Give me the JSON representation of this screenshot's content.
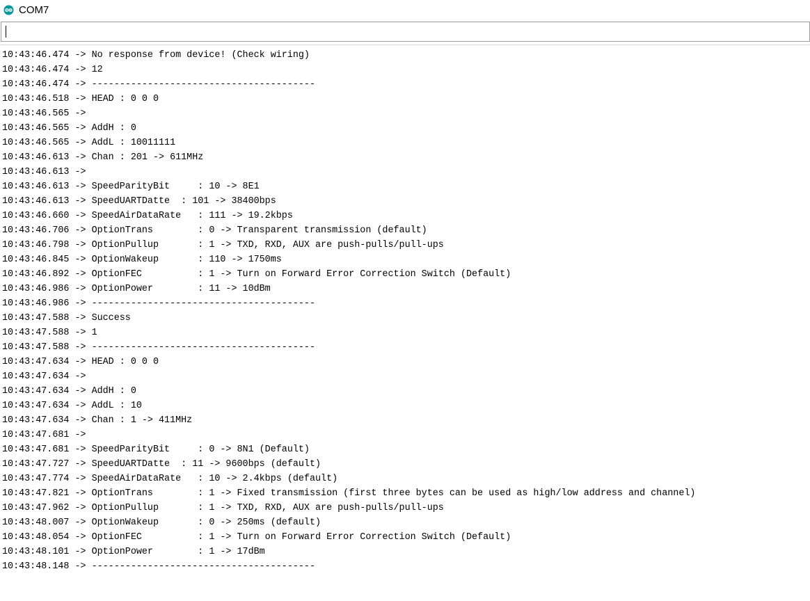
{
  "window": {
    "title": "COM7",
    "icon": "arduino-icon",
    "accent": "#00979c"
  },
  "send_input": {
    "value": "",
    "placeholder": ""
  },
  "serial_output": {
    "lines": [
      "10:43:46.474 -> No response from device! (Check wiring)",
      "10:43:46.474 -> 12",
      "10:43:46.474 -> ----------------------------------------",
      "10:43:46.518 -> HEAD : 0 0 0",
      "10:43:46.565 -> ",
      "10:43:46.565 -> AddH : 0",
      "10:43:46.565 -> AddL : 10011111",
      "10:43:46.613 -> Chan : 201 -> 611MHz",
      "10:43:46.613 -> ",
      "10:43:46.613 -> SpeedParityBit     : 10 -> 8E1",
      "10:43:46.613 -> SpeedUARTDatte  : 101 -> 38400bps",
      "10:43:46.660 -> SpeedAirDataRate   : 111 -> 19.2kbps",
      "10:43:46.706 -> OptionTrans        : 0 -> Transparent transmission (default)",
      "10:43:46.798 -> OptionPullup       : 1 -> TXD, RXD, AUX are push-pulls/pull-ups",
      "10:43:46.845 -> OptionWakeup       : 110 -> 1750ms",
      "10:43:46.892 -> OptionFEC          : 1 -> Turn on Forward Error Correction Switch (Default)",
      "10:43:46.986 -> OptionPower        : 11 -> 10dBm",
      "10:43:46.986 -> ----------------------------------------",
      "10:43:47.588 -> Success",
      "10:43:47.588 -> 1",
      "10:43:47.588 -> ----------------------------------------",
      "10:43:47.634 -> HEAD : 0 0 0",
      "10:43:47.634 -> ",
      "10:43:47.634 -> AddH : 0",
      "10:43:47.634 -> AddL : 10",
      "10:43:47.634 -> Chan : 1 -> 411MHz",
      "10:43:47.681 -> ",
      "10:43:47.681 -> SpeedParityBit     : 0 -> 8N1 (Default)",
      "10:43:47.727 -> SpeedUARTDatte  : 11 -> 9600bps (default)",
      "10:43:47.774 -> SpeedAirDataRate   : 10 -> 2.4kbps (default)",
      "10:43:47.821 -> OptionTrans        : 1 -> Fixed transmission (first three bytes can be used as high/low address and channel)",
      "10:43:47.962 -> OptionPullup       : 1 -> TXD, RXD, AUX are push-pulls/pull-ups",
      "10:43:48.007 -> OptionWakeup       : 0 -> 250ms (default)",
      "10:43:48.054 -> OptionFEC          : 1 -> Turn on Forward Error Correction Switch (Default)",
      "10:43:48.101 -> OptionPower        : 1 -> 17dBm",
      "10:43:48.148 -> ----------------------------------------"
    ]
  }
}
